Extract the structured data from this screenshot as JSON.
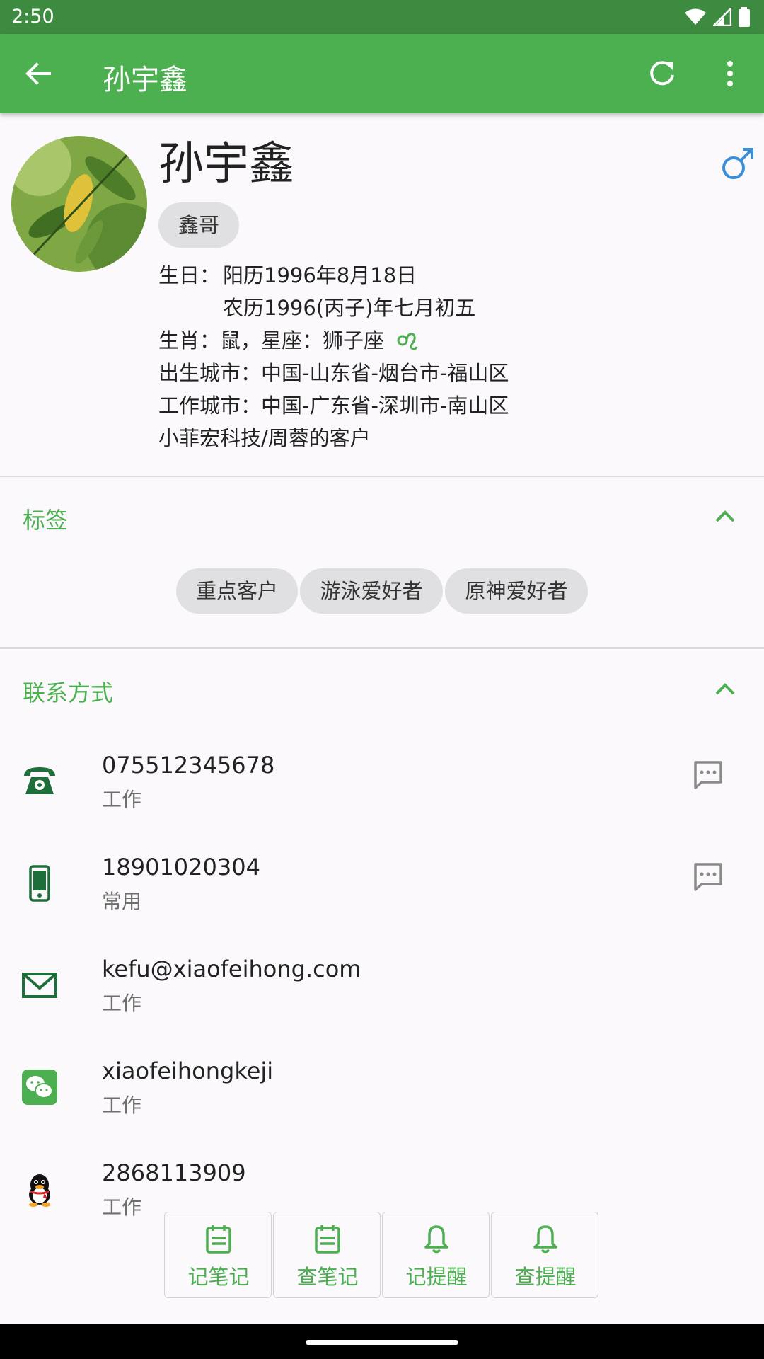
{
  "status_bar": {
    "time": "2:50"
  },
  "app_bar": {
    "title": "孙宇鑫"
  },
  "profile": {
    "name": "孙宇鑫",
    "nickname": "鑫哥",
    "birthday_label": "生日：",
    "birthday_solar": "阳历1996年8月18日",
    "birthday_lunar": "农历1996(丙子)年七月初五",
    "zodiac_line": "生肖：鼠，星座：狮子座",
    "birth_city": "出生城市：中国-山东省-烟台市-福山区",
    "work_city": "工作城市：中国-广东省-深圳市-南山区",
    "company": "小菲宏科技/周蓉的客户"
  },
  "tags_section": {
    "title": "标签",
    "tags": [
      "重点客户",
      "游泳爱好者",
      "原神爱好者"
    ]
  },
  "contact_section": {
    "title": "联系方式",
    "items": [
      {
        "icon": "telephone-icon",
        "value": "075512345678",
        "type": "工作"
      },
      {
        "icon": "mobile-phone-icon",
        "value": "18901020304",
        "type": "常用"
      },
      {
        "icon": "email-icon",
        "value": "kefu@xiaofeihong.com",
        "type": "工作"
      },
      {
        "icon": "wechat-icon",
        "value": "xiaofeihongkeji",
        "type": "工作"
      },
      {
        "icon": "qq-icon",
        "value": "2868113909",
        "type": "工作"
      }
    ]
  },
  "toolbar": {
    "buttons": [
      {
        "icon": "note-icon",
        "label": "记笔记"
      },
      {
        "icon": "note-icon",
        "label": "查笔记"
      },
      {
        "icon": "bell-icon",
        "label": "记提醒"
      },
      {
        "icon": "bell-icon",
        "label": "查提醒"
      }
    ]
  },
  "colors": {
    "primary": "#4CAF50",
    "status_bar": "#3D8B40",
    "contact_icon": "#1E6E3A",
    "gender_icon": "#3A8FD8"
  }
}
